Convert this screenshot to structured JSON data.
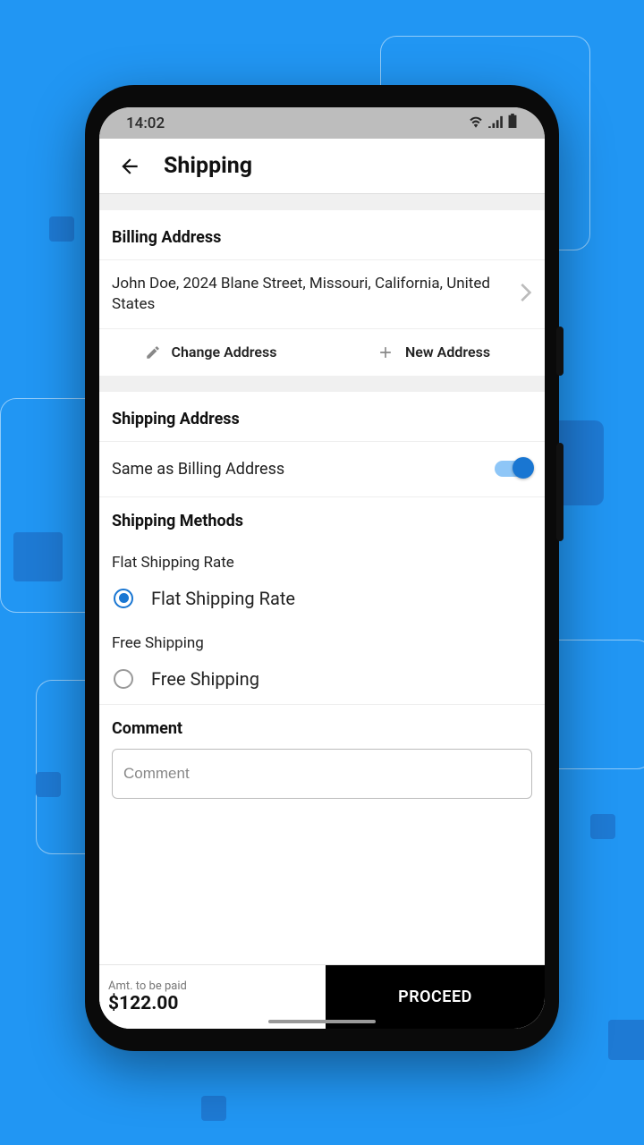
{
  "statusbar": {
    "time": "14:02"
  },
  "appbar": {
    "title": "Shipping"
  },
  "billing": {
    "title": "Billing Address",
    "address": "John  Doe, 2024  Blane Street, Missouri, California, United States",
    "change_label": "Change Address",
    "new_label": "New Address"
  },
  "shipping": {
    "title": "Shipping Address",
    "same_label": "Same as Billing Address",
    "same_as_billing": true
  },
  "methods": {
    "title": "Shipping Methods",
    "options": [
      {
        "group": "Flat Shipping Rate",
        "label": "Flat Shipping Rate",
        "selected": true
      },
      {
        "group": "Free Shipping",
        "label": "Free Shipping",
        "selected": false
      }
    ]
  },
  "comment": {
    "title": "Comment",
    "placeholder": "Comment",
    "value": ""
  },
  "footer": {
    "amt_label": "Amt. to be paid",
    "amt_value": "$122.00",
    "proceed_label": "PROCEED"
  }
}
